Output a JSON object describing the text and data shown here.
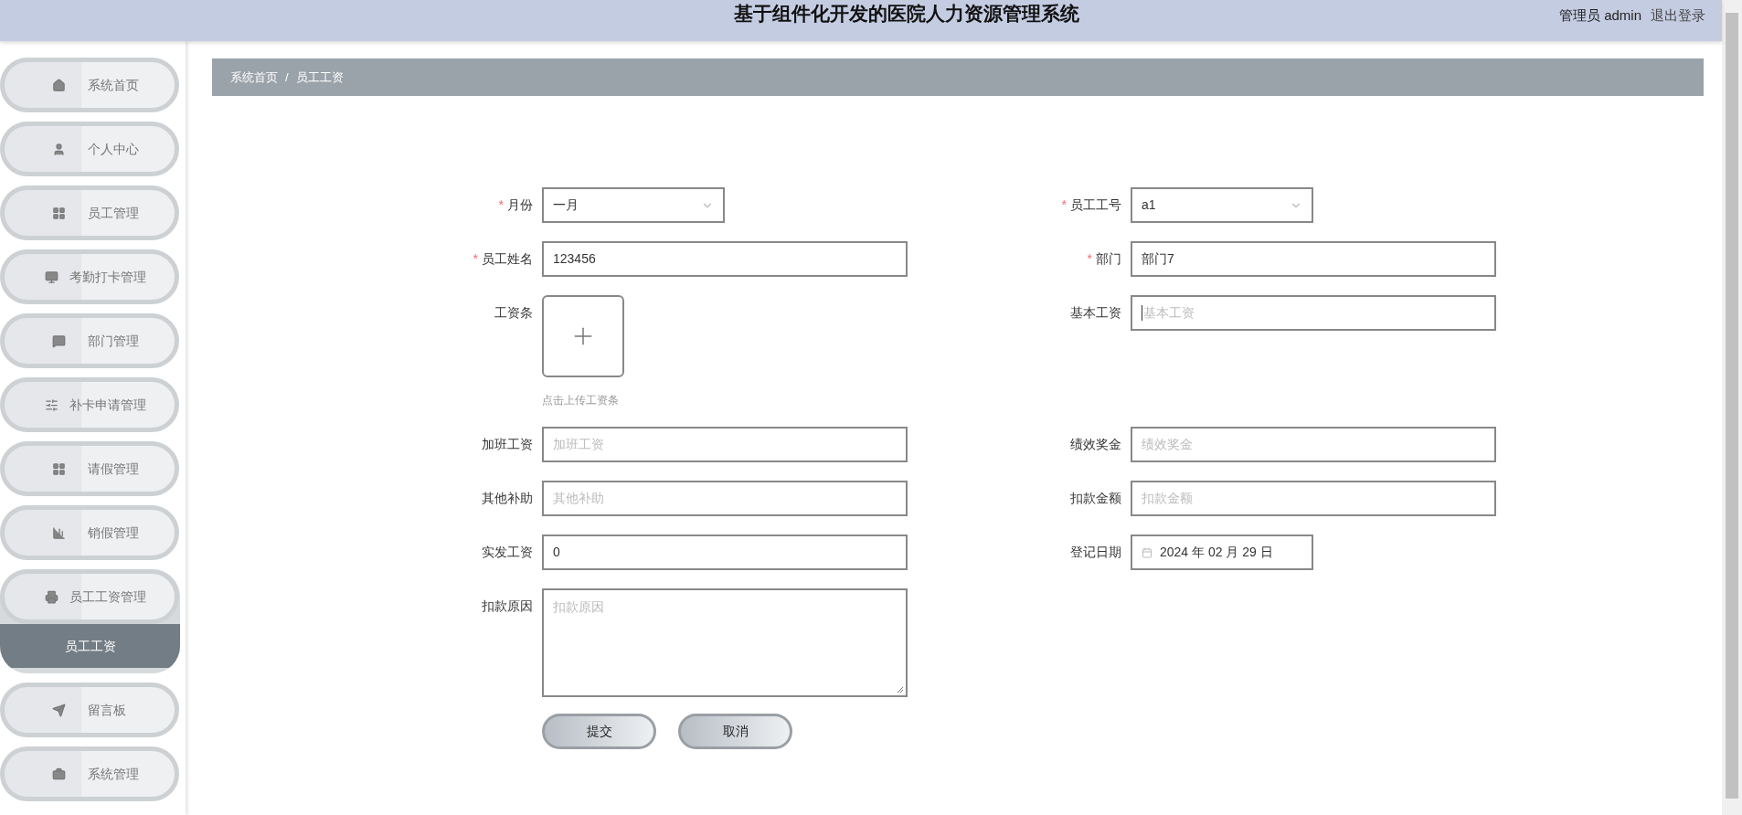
{
  "header": {
    "title": "基于组件化开发的医院人力资源管理系统",
    "user": "管理员 admin",
    "logout": "退出登录"
  },
  "sidebar": {
    "items": [
      {
        "label": "系统首页",
        "expanded": false
      },
      {
        "label": "个人中心",
        "expanded": false
      },
      {
        "label": "员工管理",
        "expanded": false
      },
      {
        "label": "考勤打卡管理",
        "expanded": false
      },
      {
        "label": "部门管理",
        "expanded": false
      },
      {
        "label": "补卡申请管理",
        "expanded": false
      },
      {
        "label": "请假管理",
        "expanded": false
      },
      {
        "label": "销假管理",
        "expanded": false
      },
      {
        "label": "员工工资管理",
        "expanded": true,
        "children": [
          {
            "label": "员工工资",
            "selected": true
          }
        ]
      },
      {
        "label": "留言板",
        "expanded": false
      },
      {
        "label": "系统管理",
        "expanded": false
      }
    ]
  },
  "breadcrumb": [
    "系统首页",
    "员工工资"
  ],
  "breadcrumb_separator": "/",
  "required_mark": "*",
  "form": {
    "rows": [
      [
        {
          "kind": "select",
          "label": "月份",
          "required": true,
          "value": "一月"
        },
        {
          "kind": "select",
          "label": "员工工号",
          "required": true,
          "value": "a1"
        }
      ],
      [
        {
          "kind": "text",
          "label": "员工姓名",
          "required": true,
          "value": "123456",
          "focused": false
        },
        {
          "kind": "text",
          "label": "部门",
          "required": true,
          "value": "部门7",
          "focused": false
        }
      ],
      [
        {
          "kind": "upload",
          "label": "工资条",
          "required": false,
          "hint": "点击上传工资条"
        },
        {
          "kind": "text",
          "label": "基本工资",
          "required": false,
          "placeholder": "基本工资",
          "focused": true
        }
      ],
      [
        {
          "kind": "text",
          "label": "加班工资",
          "required": false,
          "placeholder": "加班工资",
          "focused": false
        },
        {
          "kind": "text",
          "label": "绩效奖金",
          "required": false,
          "placeholder": "绩效奖金",
          "focused": false
        }
      ],
      [
        {
          "kind": "text",
          "label": "其他补助",
          "required": false,
          "placeholder": "其他补助",
          "focused": false
        },
        {
          "kind": "text",
          "label": "扣款金额",
          "required": false,
          "placeholder": "扣款金额",
          "focused": false
        }
      ],
      [
        {
          "kind": "text",
          "label": "实发工资",
          "required": false,
          "value": "0",
          "focused": false
        },
        {
          "kind": "date",
          "label": "登记日期",
          "required": false,
          "value": "2024 年 02 月 29 日"
        }
      ],
      [
        {
          "kind": "textarea",
          "label": "扣款原因",
          "required": false,
          "placeholder": "扣款原因"
        }
      ]
    ],
    "buttons": [
      "提交",
      "取消"
    ]
  }
}
